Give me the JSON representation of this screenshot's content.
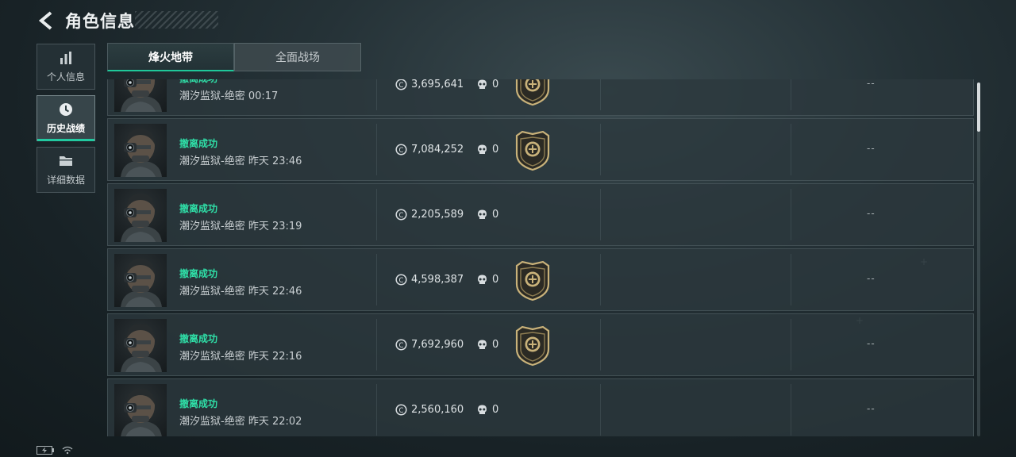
{
  "header": {
    "title": "角色信息"
  },
  "side_nav": [
    {
      "label": "个人信息",
      "icon": "bar-chart-icon",
      "active": false
    },
    {
      "label": "历史战绩",
      "icon": "history-clock-icon",
      "active": true
    },
    {
      "label": "详细数据",
      "icon": "folder-icon",
      "active": false
    }
  ],
  "tabs": [
    {
      "label": "烽火地带",
      "active": true
    },
    {
      "label": "全面战场",
      "active": false
    }
  ],
  "matches": [
    {
      "status": "撤离成功",
      "detail": "潮汐监狱-绝密 00:17",
      "money": "3,695,641",
      "kills": "0",
      "badge": true,
      "rating": "--"
    },
    {
      "status": "撤离成功",
      "detail": "潮汐监狱-绝密 昨天 23:46",
      "money": "7,084,252",
      "kills": "0",
      "badge": true,
      "rating": "--"
    },
    {
      "status": "撤离成功",
      "detail": "潮汐监狱-绝密 昨天 23:19",
      "money": "2,205,589",
      "kills": "0",
      "badge": false,
      "rating": "--"
    },
    {
      "status": "撤离成功",
      "detail": "潮汐监狱-绝密 昨天 22:46",
      "money": "4,598,387",
      "kills": "0",
      "badge": true,
      "rating": "--"
    },
    {
      "status": "撤离成功",
      "detail": "潮汐监狱-绝密 昨天 22:16",
      "money": "7,692,960",
      "kills": "0",
      "badge": true,
      "rating": "--"
    },
    {
      "status": "撤离成功",
      "detail": "潮汐监狱-绝密 昨天 22:02",
      "money": "2,560,160",
      "kills": "0",
      "badge": false,
      "rating": "--"
    }
  ],
  "colors": {
    "accent": "#1fc89a",
    "status_success": "#2fe0a8",
    "badge_gold": "#c9b27a"
  },
  "icons": {
    "back": "back-arrow-icon",
    "money": "coin-icon",
    "kills": "skull-icon",
    "badge": "rank-shield-icon"
  }
}
